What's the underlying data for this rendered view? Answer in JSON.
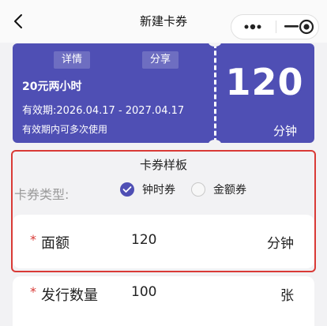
{
  "nav": {
    "title": "新建卡券"
  },
  "coupon": {
    "detail_label": "详情",
    "share_label": "分享",
    "name": "20元两小时",
    "validity": "有效期:2026.04.17 - 2027.04.17",
    "usage_note": "有效期内可多次使用",
    "amount": "120",
    "unit": "分钟"
  },
  "template": {
    "title": "卡券样板",
    "type_label": "卡券类型:",
    "options": [
      {
        "label": "钟时券",
        "selected": true
      },
      {
        "label": "金额券",
        "selected": false
      }
    ]
  },
  "form": {
    "denomination": {
      "required_mark": "*",
      "label": "面额",
      "value": "120",
      "unit": "分钟"
    },
    "quantity": {
      "required_mark": "*",
      "label": "发行数量",
      "value": "100",
      "unit": "张"
    }
  },
  "colors": {
    "accent": "#4f4fb4",
    "highlight_border": "#d93a36",
    "background": "#f2f2f4"
  }
}
